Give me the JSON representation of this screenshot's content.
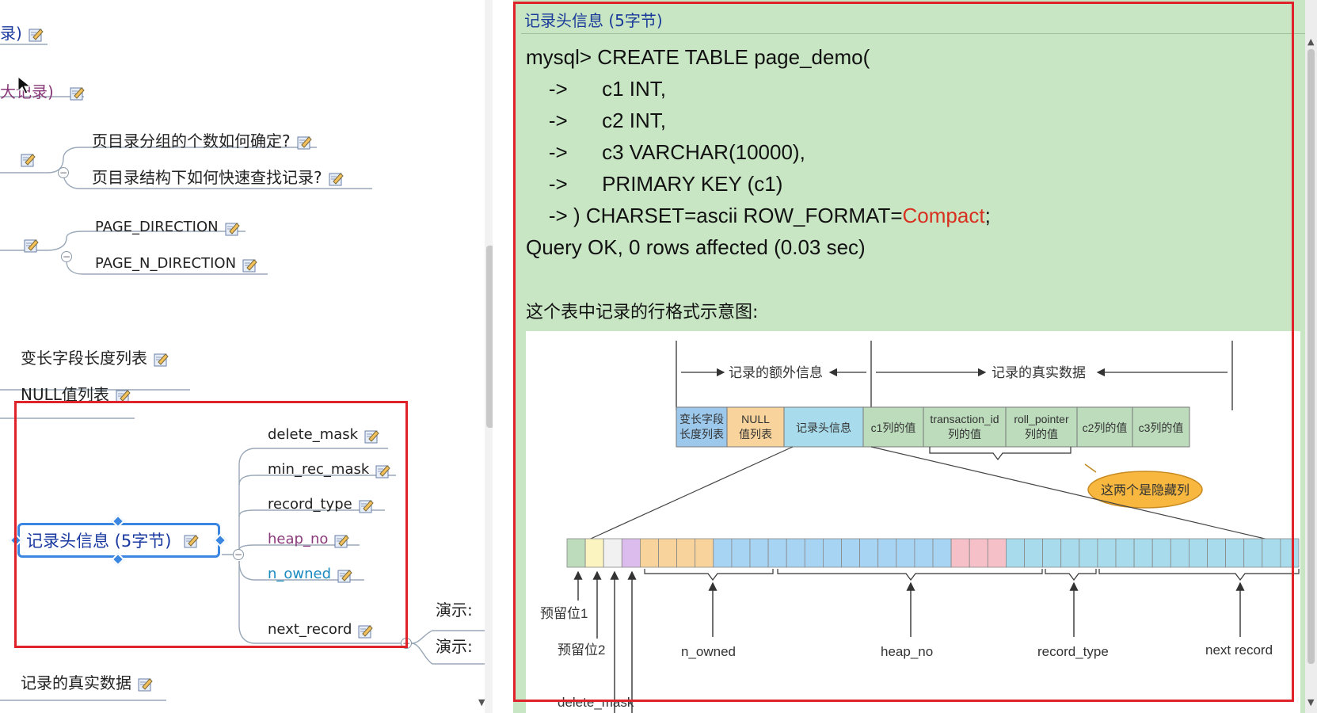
{
  "mindmap": {
    "partial_top_1": "录)",
    "partial_top_2": "大记录)",
    "dir_group_q1": "页目录分组的个数如何确定?",
    "dir_group_q2": "页目录结构下如何快速查找记录?",
    "page_direction": "PAGE_DIRECTION",
    "page_n_direction": "PAGE_N_DIRECTION",
    "var_len_list": "变长字段长度列表",
    "null_list": "NULL值列表",
    "record_header": "记录头信息 (5字节)",
    "delete_mask": "delete_mask",
    "min_rec_mask": "min_rec_mask",
    "record_type": "record_type",
    "heap_no": "heap_no",
    "n_owned": "n_owned",
    "next_record": "next_record",
    "demo_1": "演示:",
    "demo_2": "演示:",
    "real_data": "记录的真实数据"
  },
  "note": {
    "title": "记录头信息 (5字节)",
    "code_lines": [
      "mysql> CREATE TABLE page_demo(",
      "    ->      c1 INT,",
      "    ->      c2 INT,",
      "    ->      c3 VARCHAR(10000),",
      "    ->      PRIMARY KEY (c1)",
      "    -> ) CHARSET=ascii ROW_FORMAT=",
      "Query OK, 0 rows affected (0.03 sec)"
    ],
    "code_keyword": "Compact",
    "code_tail": ";",
    "caption": "这个表中记录的行格式示意图:",
    "diagram": {
      "extra_info_label": "记录的额外信息",
      "real_data_label": "记录的真实数据",
      "fields": [
        {
          "label1": "变长字段",
          "label2": "长度列表",
          "color": "#9cc8ec"
        },
        {
          "label1": "NULL",
          "label2": "值列表",
          "color": "#f8d49c"
        },
        {
          "label1": "记录头信息",
          "label2": "",
          "color": "#a8dcec"
        },
        {
          "label1": "c1列的值",
          "label2": "",
          "color": "#bcdcbc"
        },
        {
          "label1": "transaction_id",
          "label2": "列的值",
          "color": "#bcdcbc"
        },
        {
          "label1": "roll_pointer",
          "label2": "列的值",
          "color": "#bcdcbc"
        },
        {
          "label1": "c2列的值",
          "label2": "",
          "color": "#bcdcbc"
        },
        {
          "label1": "c3列的值",
          "label2": "",
          "color": "#bcdcbc"
        }
      ],
      "hidden_cols_bubble": "这两个是隐藏列",
      "bit_colors": {
        "reserved1": "#bcdcbc",
        "reserved2": "#fbf4c0",
        "delete_mask": "#f1f1f1",
        "min_rec_mask": "#dcbcec",
        "n_owned": "#f8d49c",
        "heap_no": "#a8d4f4",
        "record_type": "#f6c0c8",
        "next_record": "#a8dcec"
      },
      "labels": {
        "reserved1": "预留位1",
        "reserved2": "预留位2",
        "n_owned": "n_owned",
        "heap_no": "heap_no",
        "record_type": "record_type",
        "next_record": "next record",
        "delete_mask_partial": "delete_mask"
      }
    }
  },
  "colors": {
    "highlight_red": "#e0222a",
    "note_bg": "#c8e6c4",
    "selection_blue": "#3a86e0",
    "keyword_red": "#d83020"
  }
}
